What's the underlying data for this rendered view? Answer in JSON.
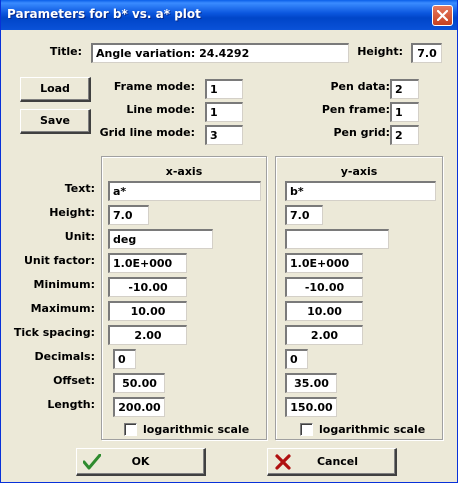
{
  "window": {
    "title": "Parameters for b* vs. a* plot"
  },
  "top": {
    "title_label": "Title:",
    "title_value": "Angle variation:    24.4292",
    "height_label": "Height:",
    "height_value": "7.0"
  },
  "buttons": {
    "load": "Load",
    "save": "Save",
    "ok": "OK",
    "cancel": "Cancel"
  },
  "modes": {
    "frame_label": "Frame mode:",
    "frame_value": "1",
    "line_label": "Line mode:",
    "line_value": "1",
    "grid_label": "Grid line mode:",
    "grid_value": "3"
  },
  "pens": {
    "data_label": "Pen data:",
    "data_value": "2",
    "frame_label": "Pen frame:",
    "frame_value": "1",
    "grid_label": "Pen grid:",
    "grid_value": "2"
  },
  "row_labels": {
    "text": "Text:",
    "height": "Height:",
    "unit": "Unit:",
    "unit_factor": "Unit factor:",
    "minimum": "Minimum:",
    "maximum": "Maximum:",
    "tick_spacing": "Tick spacing:",
    "decimals": "Decimals:",
    "offset": "Offset:",
    "length": "Length:"
  },
  "xaxis": {
    "header": "x-axis",
    "text": "a*",
    "height": "7.0",
    "unit": "deg",
    "unit_factor": "1.0E+000",
    "minimum": "-10.00",
    "maximum": "10.00",
    "tick_spacing": "2.00",
    "decimals": "0",
    "offset": "50.00",
    "length": "200.00",
    "log_label": "logarithmic scale",
    "log_checked": false
  },
  "yaxis": {
    "header": "y-axis",
    "text": "b*",
    "height": "7.0",
    "unit": "",
    "unit_factor": "1.0E+000",
    "minimum": "-10.00",
    "maximum": "10.00",
    "tick_spacing": "2.00",
    "decimals": "0",
    "offset": "35.00",
    "length": "150.00",
    "log_label": "logarithmic scale",
    "log_checked": false
  },
  "colors": {
    "titlebar": "#0a55dd",
    "face": "#ece9d8",
    "ok_check": "#2e8b2e",
    "cancel_x": "#b01010"
  }
}
